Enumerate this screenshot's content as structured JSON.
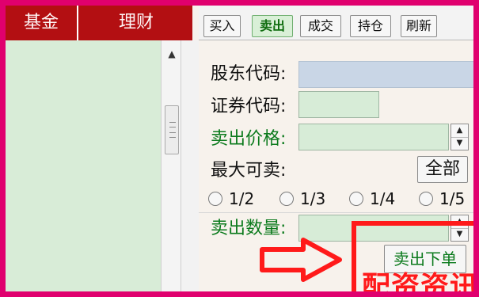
{
  "header": {
    "left_tabs": [
      "基金",
      "理财"
    ],
    "toolbar_buttons": [
      {
        "label": "买入",
        "active": false
      },
      {
        "label": "卖出",
        "active": true
      },
      {
        "label": "成交",
        "active": false
      },
      {
        "label": "持仓",
        "active": false
      },
      {
        "label": "刷新",
        "active": false
      }
    ]
  },
  "form": {
    "shareholder_code_label": "股东代码:",
    "security_code_label": "证券代码:",
    "sell_price_label": "卖出价格:",
    "max_sellable_label": "最大可卖:",
    "all_button_label": "全部",
    "radio_options": [
      "1/2",
      "1/3",
      "1/4",
      "1/5"
    ],
    "sell_quantity_label": "卖出数量:",
    "submit_button_label": "卖出下单",
    "shareholder_code_value": "",
    "security_code_value": "",
    "sell_price_value": "",
    "sell_quantity_value": ""
  },
  "annotation": {
    "watermark": "配资资讯"
  },
  "colors": {
    "frame": "#e0006e",
    "brand_red": "#b30f12",
    "active_green": "#0b7a1c",
    "field_green": "#d7ecd7",
    "field_blue": "#c9d6e6",
    "annotation_red": "#ff1a1a"
  },
  "icons": {
    "scroll_up": "chevron-up-icon",
    "scroll_thumb": "scroll-thumb-icon",
    "spinner_up": "up-icon",
    "spinner_down": "down-icon",
    "arrow": "arrow-right-icon"
  }
}
